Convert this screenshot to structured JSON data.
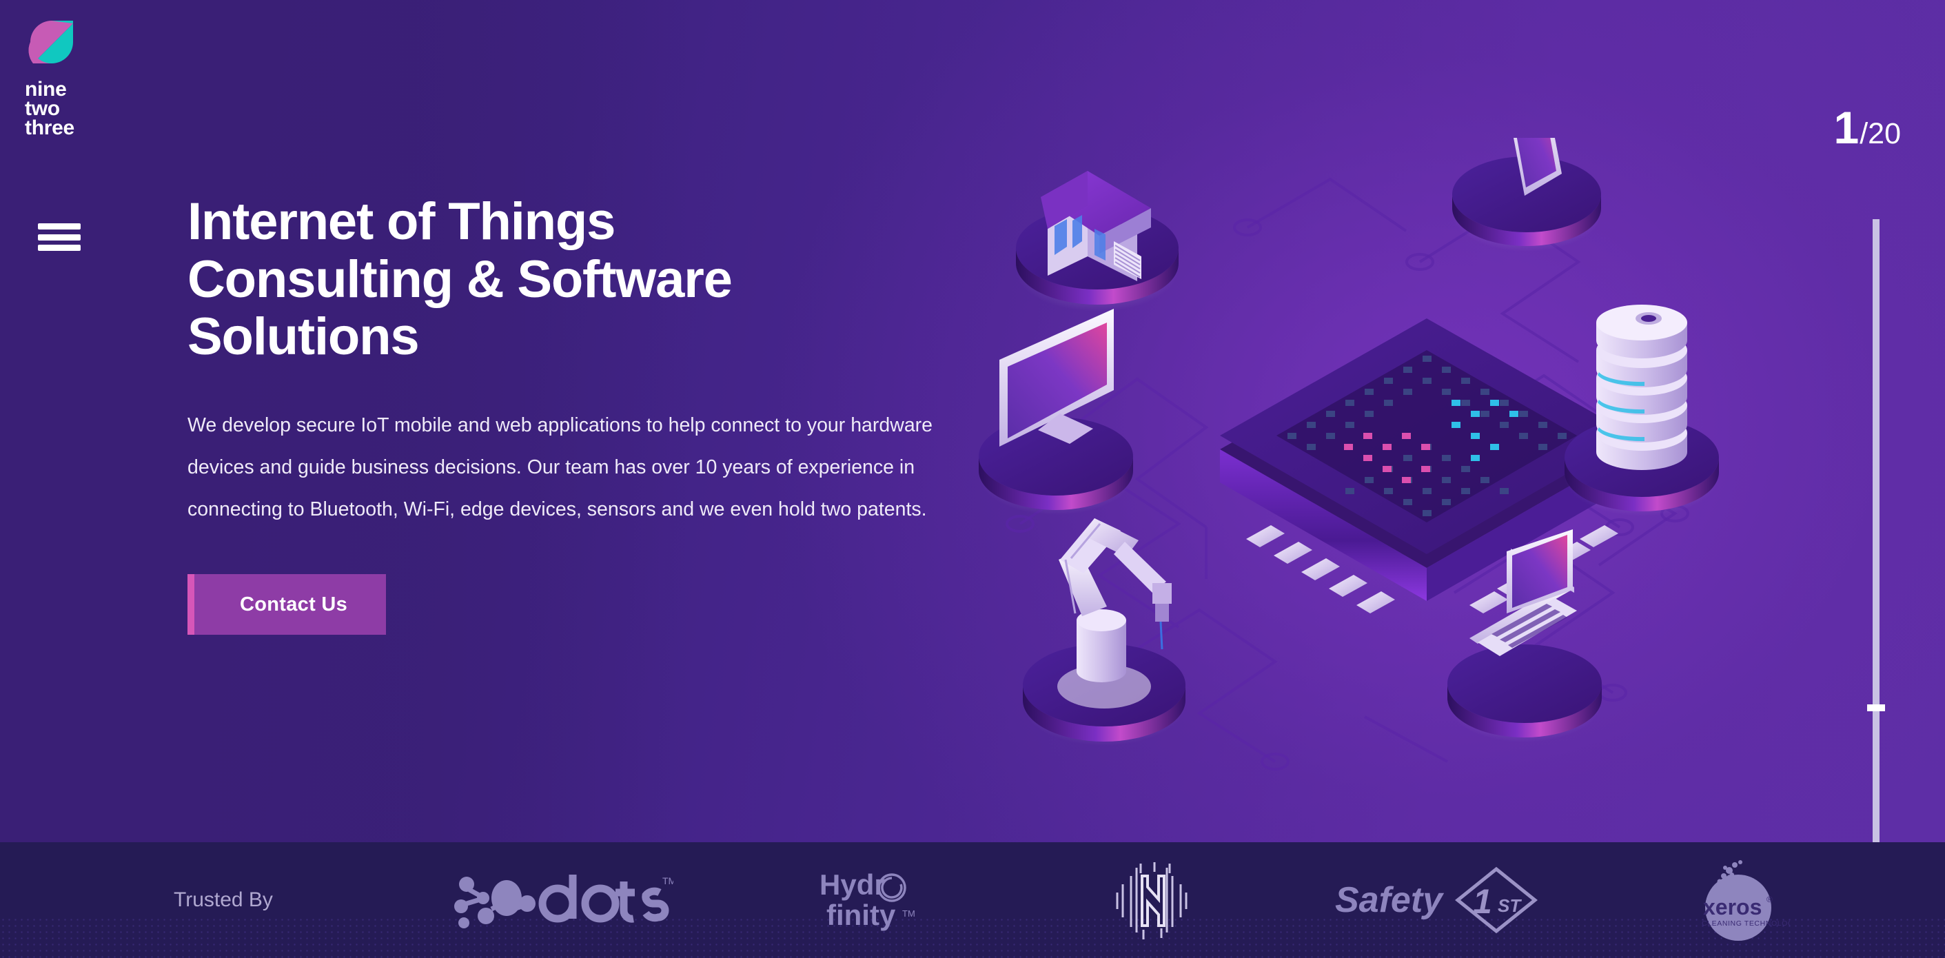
{
  "brand": {
    "logo_icon": "nine-two-three-mark",
    "name_lines": [
      "nine",
      "two",
      "three"
    ],
    "colors": {
      "teal": "#10C8C0",
      "magenta": "#CC5FB8",
      "purple_dark": "#3B2178"
    }
  },
  "nav": {
    "menu_icon": "hamburger-icon",
    "menu_label": "Menu"
  },
  "counter": {
    "current": "1",
    "total": "/20"
  },
  "hero": {
    "title": "Internet of Things Consulting & Software Solutions",
    "title_lines": [
      "Internet of Things",
      "Consulting & Software",
      "Solutions"
    ],
    "body": "We develop secure IoT mobile and web applications to help connect to your hardware devices and guide business decisions. Our team has over 10 years of experience in connecting to Bluetooth, Wi-Fi, edge devices, sensors and we even hold two patents.",
    "cta_label": "Contact Us",
    "cta_color": "#8E3CA6",
    "cta_edge_color": "#D756B8",
    "background_color": "#4A2691"
  },
  "illustration": {
    "name": "iot-isometric-network",
    "center_device": "cpu-chip",
    "devices": [
      "smart-house",
      "smartphone",
      "desktop-monitor",
      "database-stack",
      "robot-arm",
      "laptop"
    ]
  },
  "trusted": {
    "label": "Trusted By",
    "background_color": "#251B55",
    "logo_color": "#8E85BE",
    "clients": [
      {
        "name": "dots",
        "icon": "dots-logo",
        "text": "dots",
        "mark": "TM"
      },
      {
        "name": "Hydrofinity",
        "icon": "hydrofinity-logo",
        "text_top": "Hydro",
        "text_bottom": "finity",
        "mark": "TM"
      },
      {
        "name": "N",
        "icon": "n-monogram-logo",
        "text": ""
      },
      {
        "name": "Safety 1st",
        "icon": "safety-first-logo",
        "text": "Safety",
        "badge_number": "1",
        "badge_suffix": "ST"
      },
      {
        "name": "Xeros",
        "icon": "xeros-logo",
        "text": "xeros",
        "registered": "®",
        "tagline": "CLEANING TECHNOLOGIES"
      }
    ]
  }
}
